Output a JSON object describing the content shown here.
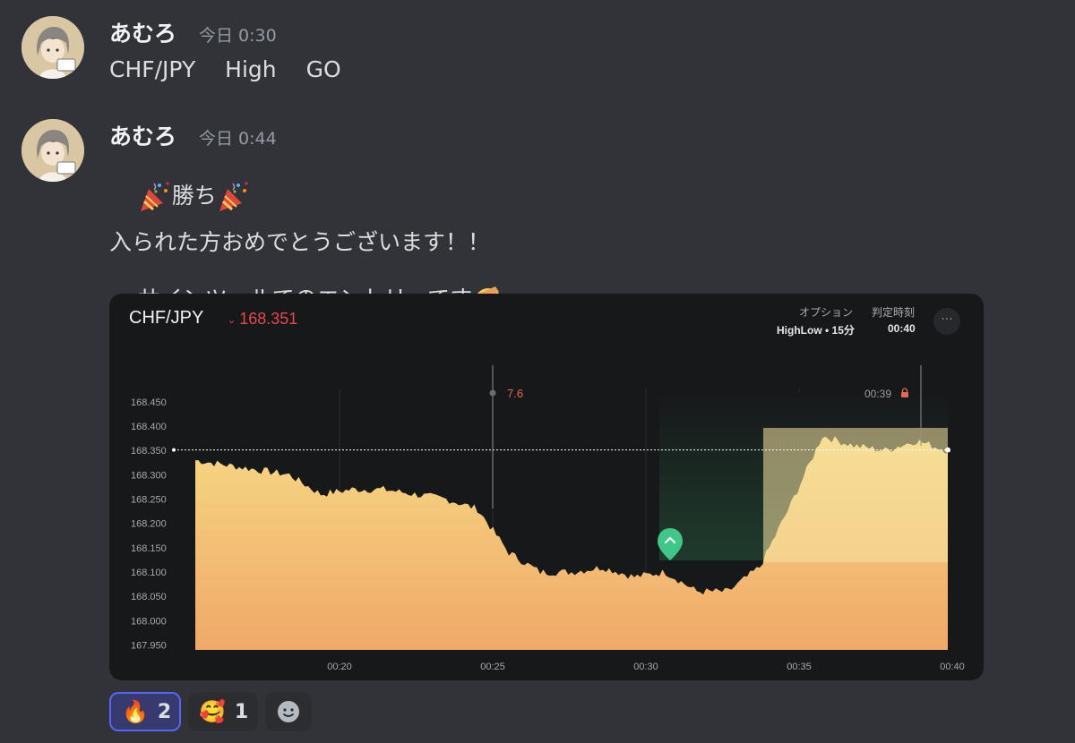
{
  "messages": [
    {
      "username": "あむろ",
      "timestamp": "今日 0:30",
      "text": "CHF/JPY　 High　 GO"
    },
    {
      "username": "あむろ",
      "timestamp": "今日 0:44",
      "line1": "勝ち",
      "line2": "入られた方おめでとうございます！！",
      "line3": "サインツールでのエントリーです",
      "emojis": [
        "party-popper",
        "party-popper",
        "saluting-face"
      ]
    }
  ],
  "embed": {
    "pair": "CHF/JPY",
    "price": "168.351",
    "price_color": "#e5484d",
    "option_label": "オプション",
    "option_value": "HighLow • 15分",
    "judge_label": "判定時刻",
    "judge_value": "00:40",
    "more_icon": "ellipsis-icon",
    "marker_label": "7.6",
    "countdown": "00:39",
    "countdown_icon": "lock-icon",
    "entry_icon": "chevron-up-icon"
  },
  "chart_data": {
    "type": "area",
    "y_ticks": [
      "168.450",
      "168.400",
      "168.350",
      "168.300",
      "168.250",
      "168.200",
      "168.150",
      "168.100",
      "168.050",
      "168.000",
      "167.950"
    ],
    "x_ticks": [
      "00:20",
      "00:25",
      "00:30",
      "00:35",
      "00:40"
    ],
    "ylim": [
      167.94,
      168.47
    ],
    "current_price": 168.351,
    "entry_price": 168.12,
    "x": [
      "00:16",
      "00:17",
      "00:18",
      "00:19",
      "00:20",
      "00:21",
      "00:22",
      "00:23",
      "00:24",
      "00:25",
      "00:26",
      "00:27",
      "00:28",
      "00:29",
      "00:30",
      "00:31",
      "00:32",
      "00:33",
      "00:34",
      "00:35",
      "00:36",
      "00:37",
      "00:38",
      "00:39",
      "00:40"
    ],
    "values": [
      168.33,
      168.32,
      168.31,
      168.3,
      168.26,
      168.27,
      168.27,
      168.26,
      168.25,
      168.23,
      168.14,
      168.1,
      168.1,
      168.11,
      168.09,
      168.1,
      168.06,
      168.06,
      168.11,
      168.24,
      168.38,
      168.36,
      168.35,
      168.37,
      168.35
    ],
    "colors": {
      "area_top": "#f6d884",
      "area_bottom": "#f0a868",
      "win_zone": "#1f3b2c",
      "entry": "#3ec789"
    }
  },
  "reactions": [
    {
      "emoji": "🔥",
      "icon": "fire-icon",
      "count": "2",
      "active": true
    },
    {
      "emoji": "🥰",
      "icon": "smiling-face-with-hearts-icon",
      "count": "1",
      "active": false
    }
  ],
  "add_reaction_icon": "add-reaction-icon"
}
